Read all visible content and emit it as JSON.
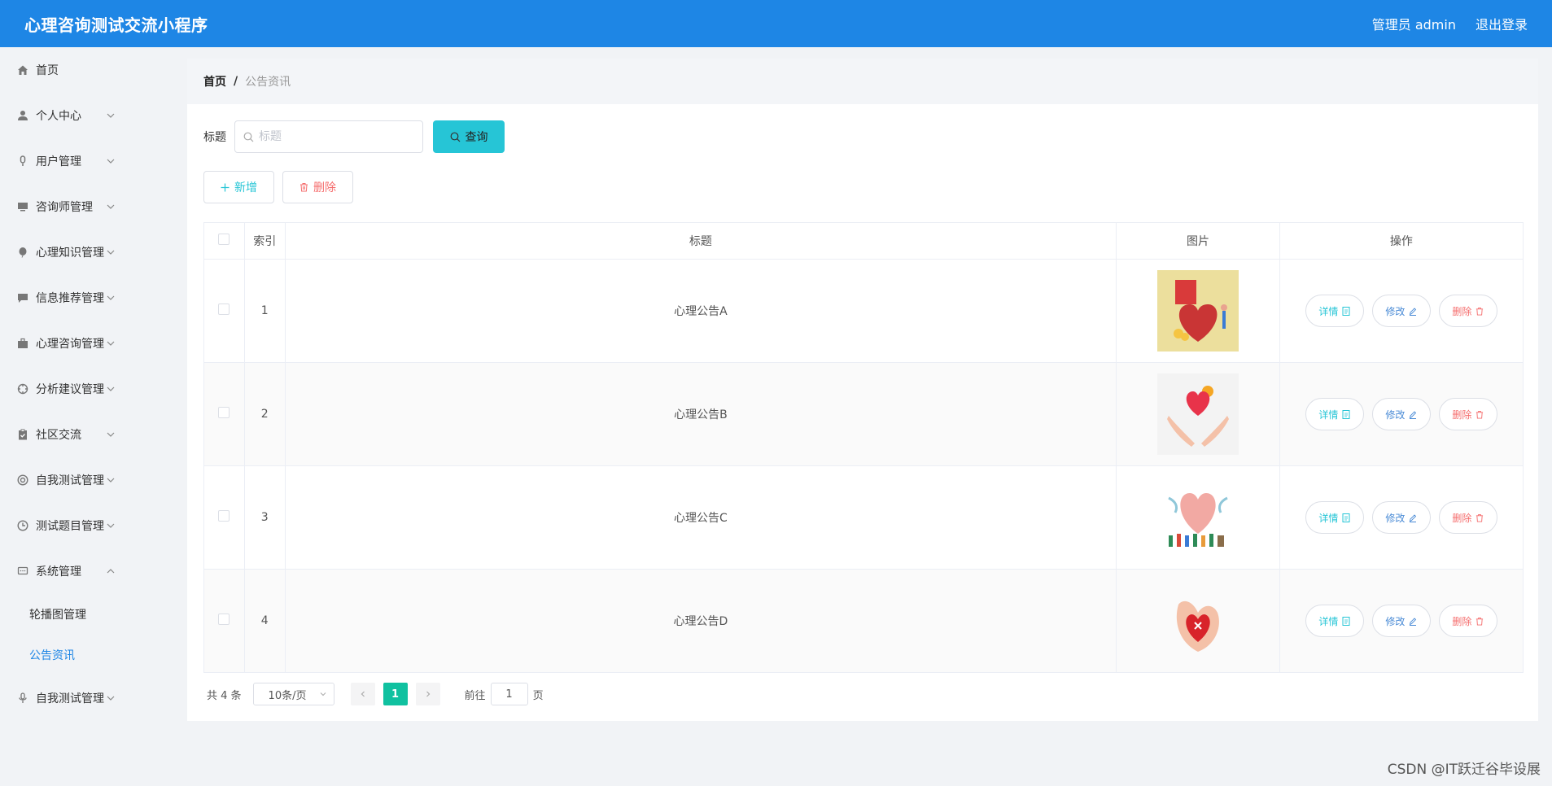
{
  "header": {
    "app_title": "心理咨询测试交流小程序",
    "user_label": "管理员 admin",
    "logout_label": "退出登录"
  },
  "sidebar": {
    "items": [
      {
        "label": "首页",
        "icon": "home-icon"
      },
      {
        "label": "个人中心",
        "icon": "user-icon"
      },
      {
        "label": "用户管理",
        "icon": "mic-icon"
      },
      {
        "label": "咨询师管理",
        "icon": "monitor-icon"
      },
      {
        "label": "心理知识管理",
        "icon": "balloon-icon"
      },
      {
        "label": "信息推荐管理",
        "icon": "chat-icon"
      },
      {
        "label": "心理咨询管理",
        "icon": "briefcase-icon"
      },
      {
        "label": "分析建议管理",
        "icon": "target-icon"
      },
      {
        "label": "社区交流",
        "icon": "clipboard-icon"
      },
      {
        "label": "自我测试管理",
        "icon": "lifebuoy-icon"
      },
      {
        "label": "测试题目管理",
        "icon": "clock-icon"
      },
      {
        "label": "系统管理",
        "icon": "message-icon"
      }
    ],
    "system_sub": [
      {
        "label": "轮播图管理"
      },
      {
        "label": "公告资讯"
      }
    ],
    "last_item": {
      "label": "自我测试管理",
      "icon": "microphone-icon"
    }
  },
  "breadcrumb": {
    "home": "首页",
    "separator": "/",
    "current": "公告资讯"
  },
  "search": {
    "label": "标题",
    "placeholder": "标题",
    "query_label": "查询"
  },
  "actions": {
    "add_label": "新增",
    "delete_label": "删除"
  },
  "table": {
    "headers": [
      "索引",
      "标题",
      "图片",
      "操作"
    ],
    "rows": [
      {
        "index": "1",
        "title": "心理公告A"
      },
      {
        "index": "2",
        "title": "心理公告B"
      },
      {
        "index": "3",
        "title": "心理公告C"
      },
      {
        "index": "4",
        "title": "心理公告D"
      }
    ],
    "ops": {
      "detail": "详情",
      "edit": "修改",
      "delete": "删除"
    }
  },
  "pagination": {
    "total": "共 4 条",
    "page_size": "10条/页",
    "current_page": "1",
    "goto_prefix": "前往",
    "goto_value": "1",
    "goto_suffix": "页"
  },
  "watermark": "CSDN @IT跃迁谷毕设展",
  "colors": {
    "header_bg": "#1e86e5",
    "accent_cyan": "#26c5d6",
    "danger": "#f56c6c",
    "page_active": "#10c1a0"
  }
}
